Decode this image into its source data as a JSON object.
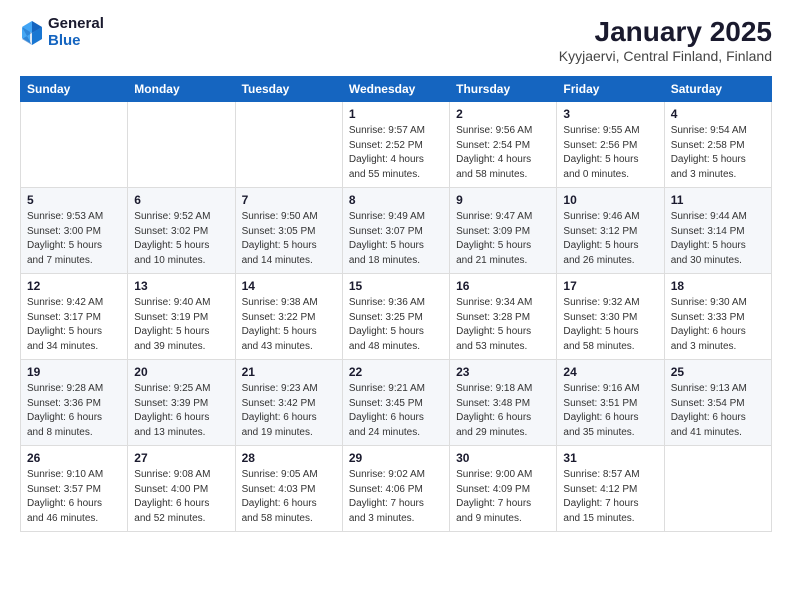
{
  "logo": {
    "general": "General",
    "blue": "Blue"
  },
  "header": {
    "title": "January 2025",
    "subtitle": "Kyyjaervi, Central Finland, Finland"
  },
  "weekdays": [
    "Sunday",
    "Monday",
    "Tuesday",
    "Wednesday",
    "Thursday",
    "Friday",
    "Saturday"
  ],
  "weeks": [
    [
      {
        "day": "",
        "info": ""
      },
      {
        "day": "",
        "info": ""
      },
      {
        "day": "",
        "info": ""
      },
      {
        "day": "1",
        "info": "Sunrise: 9:57 AM\nSunset: 2:52 PM\nDaylight: 4 hours\nand 55 minutes."
      },
      {
        "day": "2",
        "info": "Sunrise: 9:56 AM\nSunset: 2:54 PM\nDaylight: 4 hours\nand 58 minutes."
      },
      {
        "day": "3",
        "info": "Sunrise: 9:55 AM\nSunset: 2:56 PM\nDaylight: 5 hours\nand 0 minutes."
      },
      {
        "day": "4",
        "info": "Sunrise: 9:54 AM\nSunset: 2:58 PM\nDaylight: 5 hours\nand 3 minutes."
      }
    ],
    [
      {
        "day": "5",
        "info": "Sunrise: 9:53 AM\nSunset: 3:00 PM\nDaylight: 5 hours\nand 7 minutes."
      },
      {
        "day": "6",
        "info": "Sunrise: 9:52 AM\nSunset: 3:02 PM\nDaylight: 5 hours\nand 10 minutes."
      },
      {
        "day": "7",
        "info": "Sunrise: 9:50 AM\nSunset: 3:05 PM\nDaylight: 5 hours\nand 14 minutes."
      },
      {
        "day": "8",
        "info": "Sunrise: 9:49 AM\nSunset: 3:07 PM\nDaylight: 5 hours\nand 18 minutes."
      },
      {
        "day": "9",
        "info": "Sunrise: 9:47 AM\nSunset: 3:09 PM\nDaylight: 5 hours\nand 21 minutes."
      },
      {
        "day": "10",
        "info": "Sunrise: 9:46 AM\nSunset: 3:12 PM\nDaylight: 5 hours\nand 26 minutes."
      },
      {
        "day": "11",
        "info": "Sunrise: 9:44 AM\nSunset: 3:14 PM\nDaylight: 5 hours\nand 30 minutes."
      }
    ],
    [
      {
        "day": "12",
        "info": "Sunrise: 9:42 AM\nSunset: 3:17 PM\nDaylight: 5 hours\nand 34 minutes."
      },
      {
        "day": "13",
        "info": "Sunrise: 9:40 AM\nSunset: 3:19 PM\nDaylight: 5 hours\nand 39 minutes."
      },
      {
        "day": "14",
        "info": "Sunrise: 9:38 AM\nSunset: 3:22 PM\nDaylight: 5 hours\nand 43 minutes."
      },
      {
        "day": "15",
        "info": "Sunrise: 9:36 AM\nSunset: 3:25 PM\nDaylight: 5 hours\nand 48 minutes."
      },
      {
        "day": "16",
        "info": "Sunrise: 9:34 AM\nSunset: 3:28 PM\nDaylight: 5 hours\nand 53 minutes."
      },
      {
        "day": "17",
        "info": "Sunrise: 9:32 AM\nSunset: 3:30 PM\nDaylight: 5 hours\nand 58 minutes."
      },
      {
        "day": "18",
        "info": "Sunrise: 9:30 AM\nSunset: 3:33 PM\nDaylight: 6 hours\nand 3 minutes."
      }
    ],
    [
      {
        "day": "19",
        "info": "Sunrise: 9:28 AM\nSunset: 3:36 PM\nDaylight: 6 hours\nand 8 minutes."
      },
      {
        "day": "20",
        "info": "Sunrise: 9:25 AM\nSunset: 3:39 PM\nDaylight: 6 hours\nand 13 minutes."
      },
      {
        "day": "21",
        "info": "Sunrise: 9:23 AM\nSunset: 3:42 PM\nDaylight: 6 hours\nand 19 minutes."
      },
      {
        "day": "22",
        "info": "Sunrise: 9:21 AM\nSunset: 3:45 PM\nDaylight: 6 hours\nand 24 minutes."
      },
      {
        "day": "23",
        "info": "Sunrise: 9:18 AM\nSunset: 3:48 PM\nDaylight: 6 hours\nand 29 minutes."
      },
      {
        "day": "24",
        "info": "Sunrise: 9:16 AM\nSunset: 3:51 PM\nDaylight: 6 hours\nand 35 minutes."
      },
      {
        "day": "25",
        "info": "Sunrise: 9:13 AM\nSunset: 3:54 PM\nDaylight: 6 hours\nand 41 minutes."
      }
    ],
    [
      {
        "day": "26",
        "info": "Sunrise: 9:10 AM\nSunset: 3:57 PM\nDaylight: 6 hours\nand 46 minutes."
      },
      {
        "day": "27",
        "info": "Sunrise: 9:08 AM\nSunset: 4:00 PM\nDaylight: 6 hours\nand 52 minutes."
      },
      {
        "day": "28",
        "info": "Sunrise: 9:05 AM\nSunset: 4:03 PM\nDaylight: 6 hours\nand 58 minutes."
      },
      {
        "day": "29",
        "info": "Sunrise: 9:02 AM\nSunset: 4:06 PM\nDaylight: 7 hours\nand 3 minutes."
      },
      {
        "day": "30",
        "info": "Sunrise: 9:00 AM\nSunset: 4:09 PM\nDaylight: 7 hours\nand 9 minutes."
      },
      {
        "day": "31",
        "info": "Sunrise: 8:57 AM\nSunset: 4:12 PM\nDaylight: 7 hours\nand 15 minutes."
      },
      {
        "day": "",
        "info": ""
      }
    ]
  ]
}
